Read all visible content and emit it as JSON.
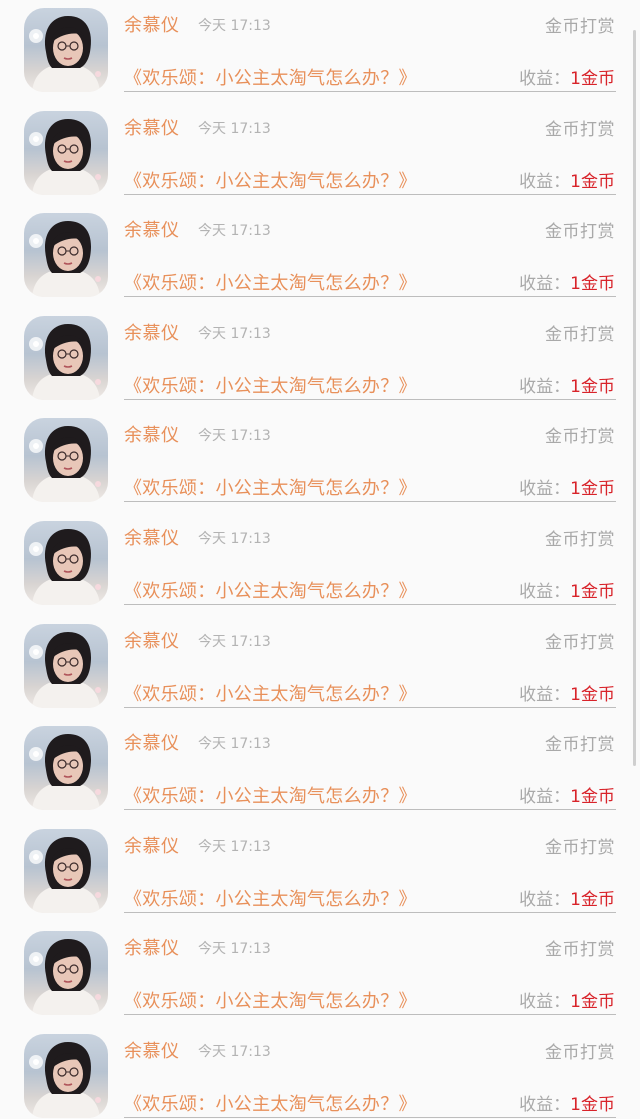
{
  "colors": {
    "accent": "#e8905a",
    "muted": "#a9a9a9",
    "income_value": "#d8232a",
    "background": "#fafafa"
  },
  "records": [
    {
      "name": "余慕仪",
      "time": "今天 17:13",
      "type": "金币打赏",
      "title": "《欢乐颂：小公主太淘气怎么办？》",
      "income_label": "收益：",
      "income_value": "1金币"
    },
    {
      "name": "余慕仪",
      "time": "今天 17:13",
      "type": "金币打赏",
      "title": "《欢乐颂：小公主太淘气怎么办？》",
      "income_label": "收益：",
      "income_value": "1金币"
    },
    {
      "name": "余慕仪",
      "time": "今天 17:13",
      "type": "金币打赏",
      "title": "《欢乐颂：小公主太淘气怎么办？》",
      "income_label": "收益：",
      "income_value": "1金币"
    },
    {
      "name": "余慕仪",
      "time": "今天 17:13",
      "type": "金币打赏",
      "title": "《欢乐颂：小公主太淘气怎么办？》",
      "income_label": "收益：",
      "income_value": "1金币"
    },
    {
      "name": "余慕仪",
      "time": "今天 17:13",
      "type": "金币打赏",
      "title": "《欢乐颂：小公主太淘气怎么办？》",
      "income_label": "收益：",
      "income_value": "1金币"
    },
    {
      "name": "余慕仪",
      "time": "今天 17:13",
      "type": "金币打赏",
      "title": "《欢乐颂：小公主太淘气怎么办？》",
      "income_label": "收益：",
      "income_value": "1金币"
    },
    {
      "name": "余慕仪",
      "time": "今天 17:13",
      "type": "金币打赏",
      "title": "《欢乐颂：小公主太淘气怎么办？》",
      "income_label": "收益：",
      "income_value": "1金币"
    },
    {
      "name": "余慕仪",
      "time": "今天 17:13",
      "type": "金币打赏",
      "title": "《欢乐颂：小公主太淘气怎么办？》",
      "income_label": "收益：",
      "income_value": "1金币"
    },
    {
      "name": "余慕仪",
      "time": "今天 17:13",
      "type": "金币打赏",
      "title": "《欢乐颂：小公主太淘气怎么办？》",
      "income_label": "收益：",
      "income_value": "1金币"
    },
    {
      "name": "余慕仪",
      "time": "今天 17:13",
      "type": "金币打赏",
      "title": "《欢乐颂：小公主太淘气怎么办？》",
      "income_label": "收益：",
      "income_value": "1金币"
    },
    {
      "name": "余慕仪",
      "time": "今天 17:13",
      "type": "金币打赏",
      "title": "《欢乐颂：小公主太淘气怎么办？》",
      "income_label": "收益：",
      "income_value": "1金币"
    }
  ]
}
